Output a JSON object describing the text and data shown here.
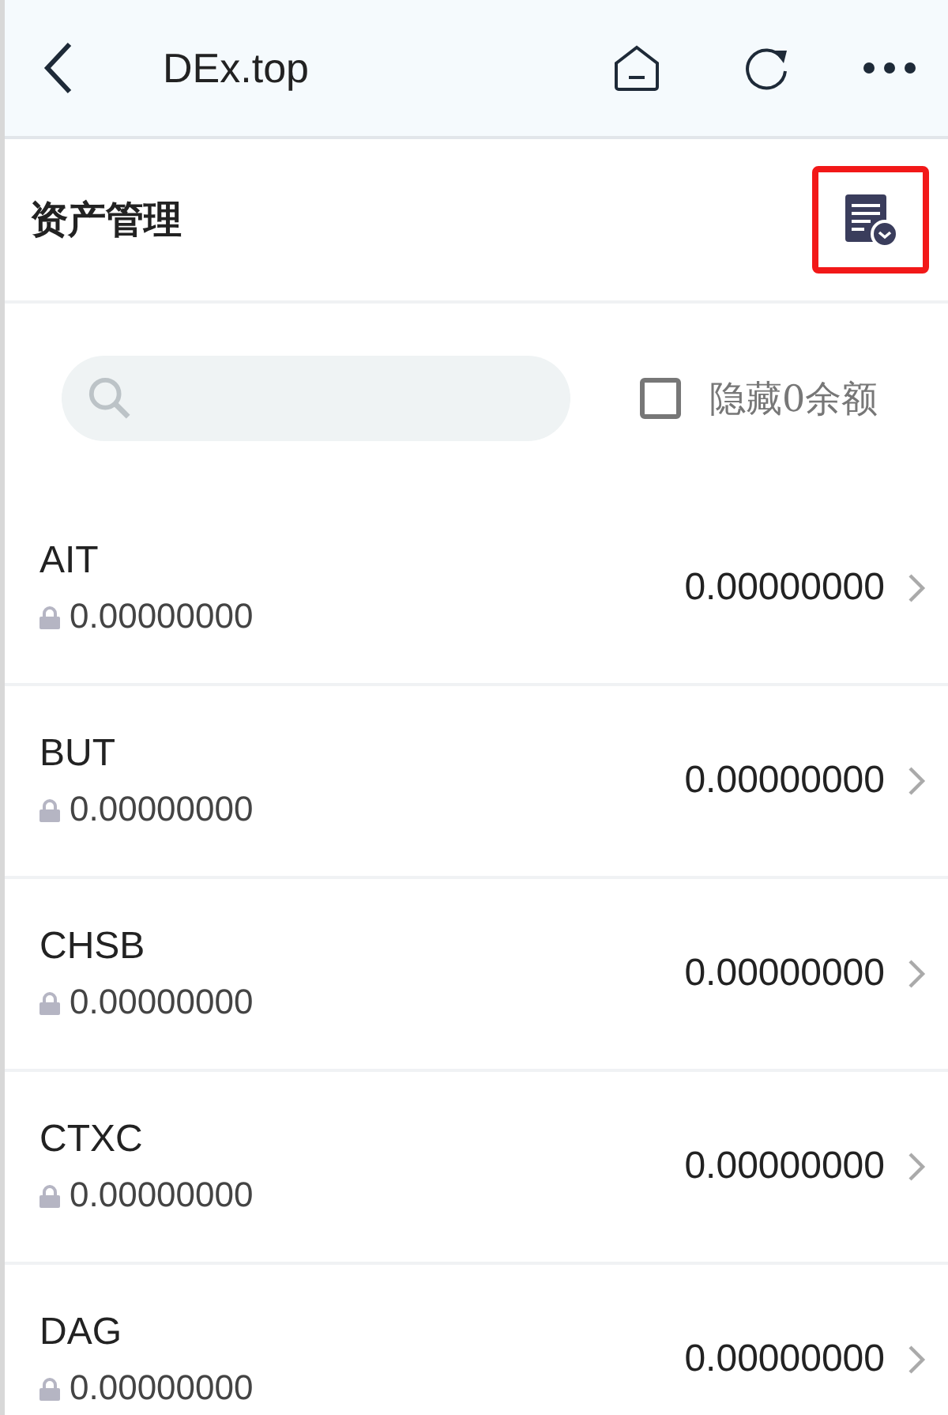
{
  "top_bar": {
    "title": "DEx.top"
  },
  "page_header": {
    "title": "资产管理",
    "records_button": {
      "highlighted": true
    }
  },
  "filter": {
    "hide_zero": {
      "label": "隐藏0余额",
      "checked": false
    }
  },
  "assets": [
    {
      "symbol": "AIT",
      "locked": "0.00000000",
      "balance": "0.00000000"
    },
    {
      "symbol": "BUT",
      "locked": "0.00000000",
      "balance": "0.00000000"
    },
    {
      "symbol": "CHSB",
      "locked": "0.00000000",
      "balance": "0.00000000"
    },
    {
      "symbol": "CTXC",
      "locked": "0.00000000",
      "balance": "0.00000000"
    },
    {
      "symbol": "DAG",
      "locked": "0.00000000",
      "balance": "0.00000000"
    }
  ]
}
